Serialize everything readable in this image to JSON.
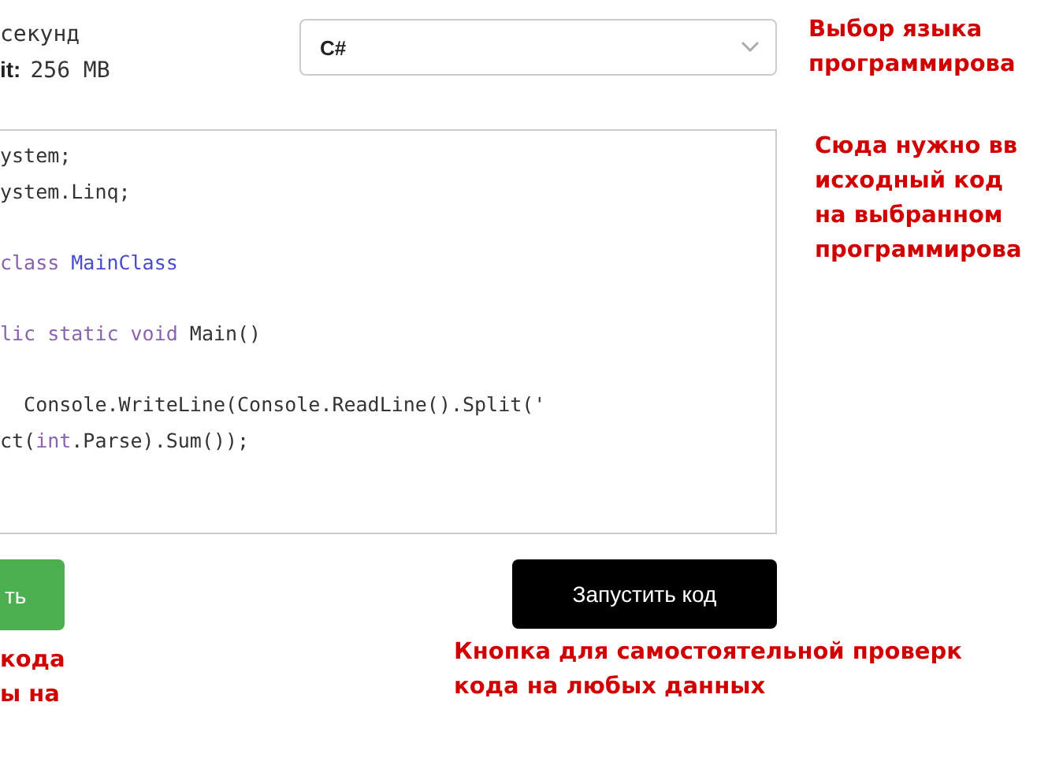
{
  "limits": {
    "time": "секунд",
    "memory_label": "it:",
    "memory": "256 MB"
  },
  "language_select": {
    "value": "C#"
  },
  "language_note": [
    "Выбор языка",
    "программирова"
  ],
  "editor": {
    "lines": [
      {
        "blank_before": false,
        "tokens": [
          {
            "kind": "plain",
            "text": "ystem;"
          }
        ]
      },
      {
        "blank_before": false,
        "tokens": [
          {
            "kind": "plain",
            "text": "ystem.Linq;"
          }
        ]
      },
      {
        "blank_before": true,
        "tokens": [
          {
            "kind": "keyword",
            "text": "class "
          },
          {
            "kind": "type",
            "text": "MainClass"
          }
        ]
      },
      {
        "blank_before": true,
        "tokens": [
          {
            "kind": "keyword",
            "text": "lic static void "
          },
          {
            "kind": "plain",
            "text": "Main()"
          }
        ]
      },
      {
        "blank_before": true,
        "tokens": [
          {
            "kind": "plain",
            "text": "  Console.WriteLine(Console.ReadLine().Split('"
          }
        ]
      },
      {
        "blank_before": false,
        "tokens": [
          {
            "kind": "plain",
            "text": "ct("
          },
          {
            "kind": "keyword",
            "text": "int"
          },
          {
            "kind": "plain",
            "text": ".Parse).Sum());"
          }
        ]
      }
    ]
  },
  "editor_note": [
    "Сюда нужно вв",
    "исходный код",
    "на выбранном",
    "программирова"
  ],
  "submit_button": {
    "label": "ть"
  },
  "submit_note": [
    "кода",
    "ы на"
  ],
  "run_button": {
    "label": "Запустить код"
  },
  "run_note": [
    "Кнопка для самостоятельной проверк",
    "кода на любых данных"
  ]
}
